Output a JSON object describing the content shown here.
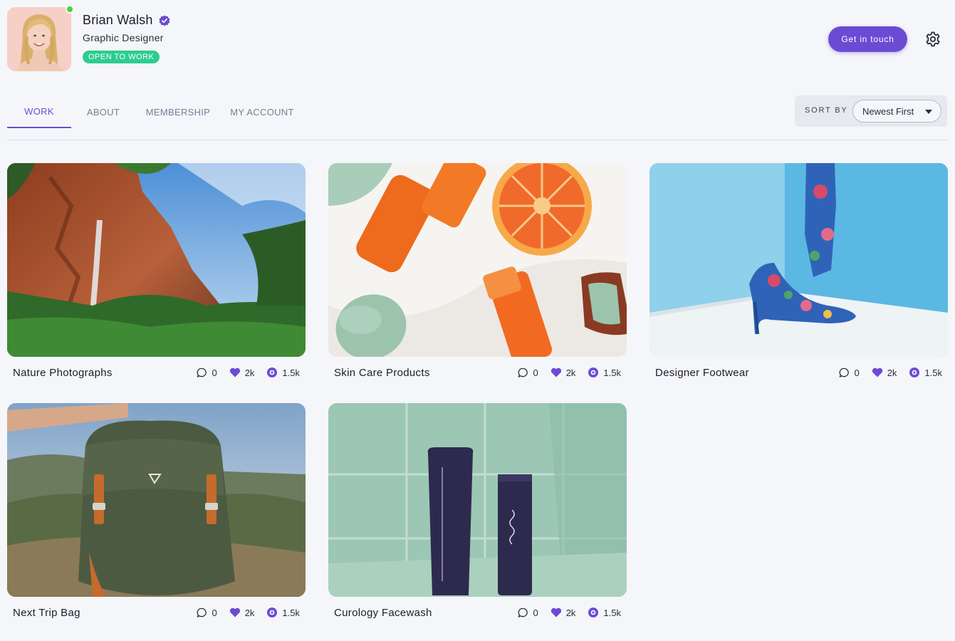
{
  "profile": {
    "name": "Brian Walsh",
    "role": "Graphic Designer",
    "status": "OPEN TO WORK",
    "online": true
  },
  "header": {
    "contact_label": "Get in touch"
  },
  "tabs": [
    {
      "label": "WORK",
      "active": true
    },
    {
      "label": "ABOUT",
      "active": false
    },
    {
      "label": "MEMBERSHIP",
      "active": false
    },
    {
      "label": "MY ACCOUNT",
      "active": false
    }
  ],
  "sort": {
    "label": "SORT BY",
    "selected": "Newest First"
  },
  "projects": [
    {
      "title": "Nature Photographs",
      "comments": "0",
      "likes": "2k",
      "views": "1.5k"
    },
    {
      "title": "Skin Care Products",
      "comments": "0",
      "likes": "2k",
      "views": "1.5k"
    },
    {
      "title": "Designer Footwear",
      "comments": "0",
      "likes": "2k",
      "views": "1.5k"
    },
    {
      "title": "Next Trip Bag",
      "comments": "0",
      "likes": "2k",
      "views": "1.5k"
    },
    {
      "title": "Curology Facewash",
      "comments": "0",
      "likes": "2k",
      "views": "1.5k"
    }
  ],
  "colors": {
    "accent": "#6c4bd4",
    "status_badge": "#2dcc8f",
    "online_dot": "#4cd13a",
    "background": "#f5f6fa"
  },
  "icons": {
    "verified": "verified-badge-icon",
    "settings": "gear-icon",
    "comments": "speech-bubble-icon",
    "likes": "heart-icon",
    "views": "eye-icon",
    "sort": "chevron-down-icon"
  }
}
